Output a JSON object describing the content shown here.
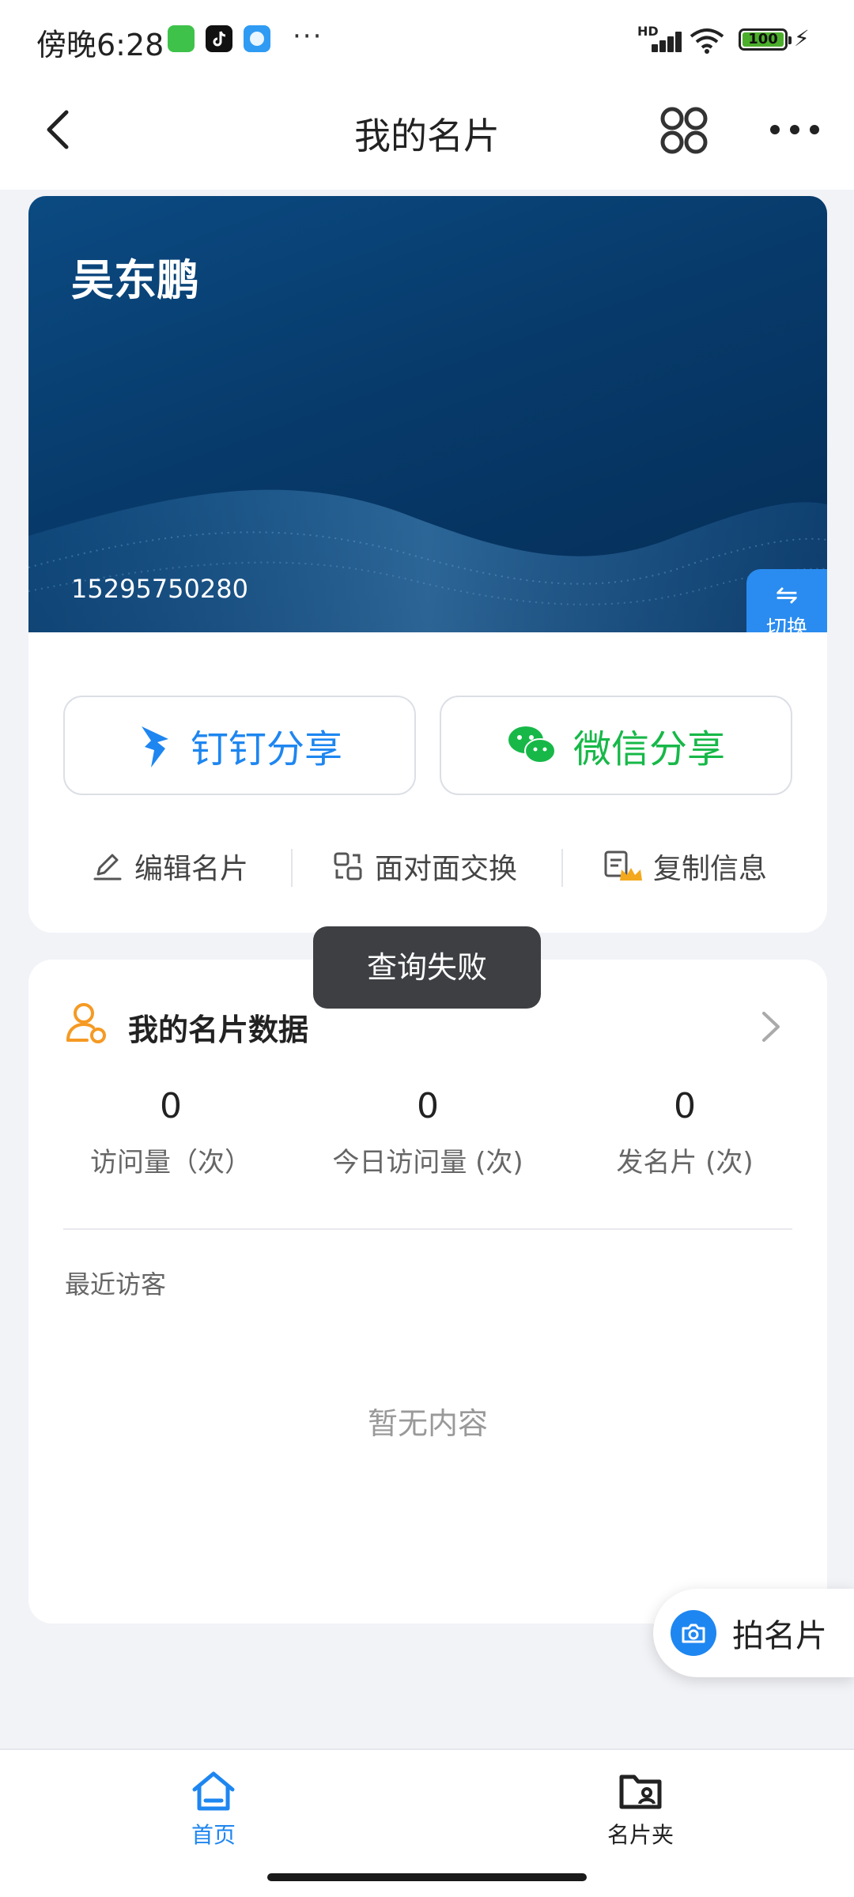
{
  "status_bar": {
    "time": "傍晚6:28",
    "network": "HD",
    "battery": "100",
    "more": "···",
    "app_icons": [
      "wechat-icon",
      "tiktok-icon",
      "browser-icon"
    ]
  },
  "nav": {
    "title": "我的名片",
    "back_icon": "chevron-left-icon",
    "apps_icon": "apps-icon",
    "more_icon": "more-icon"
  },
  "card": {
    "name": "吴东鹏",
    "phone": "15295750280",
    "switch_label": "切换"
  },
  "share": {
    "dingtalk_label": "钉钉分享",
    "wechat_label": "微信分享"
  },
  "operations": {
    "edit_label": "编辑名片",
    "exchange_label": "面对面交换",
    "copy_label": "复制信息"
  },
  "toast": "查询失败",
  "data_panel": {
    "title": "我的名片数据",
    "stats": [
      {
        "value": "0",
        "label": "访问量（次）"
      },
      {
        "value": "0",
        "label": "今日访问量 (次)"
      },
      {
        "value": "0",
        "label": "发名片 (次)"
      }
    ],
    "recent_label": "最近访客",
    "empty_text": "暂无内容"
  },
  "fab": {
    "label": "拍名片"
  },
  "bottom_nav": {
    "home_label": "首页",
    "folder_label": "名片夹"
  },
  "colors": {
    "accent": "#1e86f0",
    "wechat_green": "#17b848",
    "card_blue": "#073a6a"
  }
}
